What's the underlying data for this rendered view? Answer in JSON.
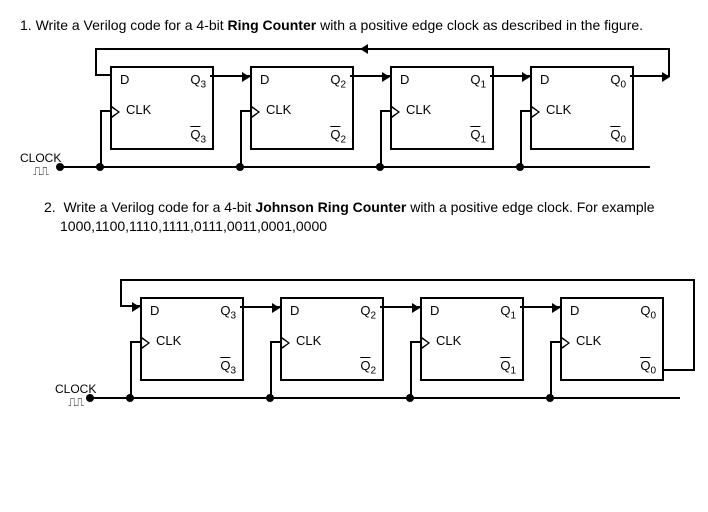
{
  "q1": {
    "number": "1.",
    "text_before": "Write a Verilog code for a 4-bit ",
    "bold": "Ring Counter",
    "text_after": " with a positive edge clock as described in the figure."
  },
  "q2": {
    "number": "2.",
    "text_before": "Write a Verilog code for a 4-bit ",
    "bold": "Johnson Ring Counter",
    "text_after": " with a positive edge clock. For example",
    "sequence": "1000,1100,1110,1111,0111,0011,0001,0000"
  },
  "ff": {
    "d": "D",
    "clk": "CLK",
    "q3": "Q",
    "q3_sub": "3",
    "q2": "Q",
    "q2_sub": "2",
    "q1": "Q",
    "q1_sub": "1",
    "q0": "Q",
    "q0_sub": "0",
    "qb": "Q"
  },
  "clock": {
    "label": "CLOCK",
    "wave": "⎍⎍"
  }
}
